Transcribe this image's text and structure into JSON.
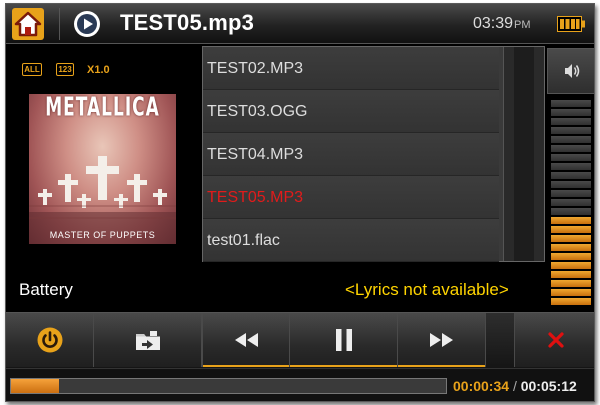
{
  "header": {
    "title": "TEST05.mp3",
    "time": "03:39",
    "ampm": "PM"
  },
  "playback": {
    "repeat_icon_label": "ALL",
    "order_icon_label": "123",
    "speed": "X1.0"
  },
  "album": {
    "band_text": "METALLICA",
    "caption": "MASTER OF PUPPETS"
  },
  "now_playing": {
    "track_title": "Battery",
    "lyrics": "<Lyrics not available>"
  },
  "playlist": {
    "items": [
      {
        "label": "TEST02.MP3",
        "current": false
      },
      {
        "label": "TEST03.OGG",
        "current": false
      },
      {
        "label": "TEST04.MP3",
        "current": false
      },
      {
        "label": "TEST05.MP3",
        "current": true
      },
      {
        "label": "test01.flac",
        "current": false
      }
    ]
  },
  "volume": {
    "level_fraction": 0.45
  },
  "controls": {
    "power": "power-icon",
    "folder": "folder-icon",
    "rewind": "rewind-icon",
    "pause": "pause-icon",
    "fast_forward": "fast-forward-icon",
    "close": "close-icon"
  },
  "progress": {
    "elapsed": "00:00:34",
    "separator": "/",
    "total": "00:05:12",
    "fraction": 0.11
  },
  "colors": {
    "accent": "#e8a21a",
    "current_track": "#e11b1b",
    "lyrics": "#ffd400",
    "close": "#e01010"
  }
}
